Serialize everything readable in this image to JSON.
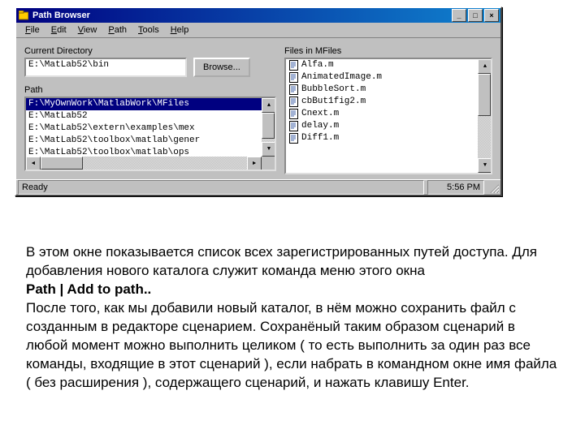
{
  "window": {
    "title": "Path Browser",
    "menus": [
      "File",
      "Edit",
      "View",
      "Path",
      "Tools",
      "Help"
    ],
    "currentDirLabel": "Current Directory",
    "currentDir": "E:\\MatLab52\\bin",
    "browseLabel": "Browse...",
    "pathLabel": "Path",
    "pathEntries": [
      "F:\\MyOwnWork\\MatlabWork\\MFiles",
      "E:\\MatLab52",
      "E:\\MatLab52\\extern\\examples\\mex",
      "E:\\MatLab52\\toolbox\\matlab\\gener",
      "E:\\MatLab52\\toolbox\\matlab\\ops"
    ],
    "pathSelectedIndex": 0,
    "filesLabel": "Files in MFiles",
    "files": [
      "Alfa.m",
      "AnimatedImage.m",
      "BubbleSort.m",
      "cbBut1fig2.m",
      "Cnext.m",
      "delay.m",
      "Diff1.m"
    ],
    "statusReady": "Ready",
    "statusTime": "5:56 PM"
  },
  "body": {
    "p1": "В этом окне показывается список всех зарегистрированных путей доступа. Для добавления нового каталога служит команда меню этого окна",
    "pBold": "Path | Add to path..",
    "p2": " После того, как мы добавили новый каталог, в нём можно сохранить файл с созданным в редакторе сценарием. Сохранёный таким образом сценарий в любой момент можно выполнить целиком ( то есть выполнить за один раз все команды, входящие в этот сценарий ), если набрать в командном окне имя файла ( без расширения ), содержащего сценарий, и нажать клавишу Enter."
  }
}
